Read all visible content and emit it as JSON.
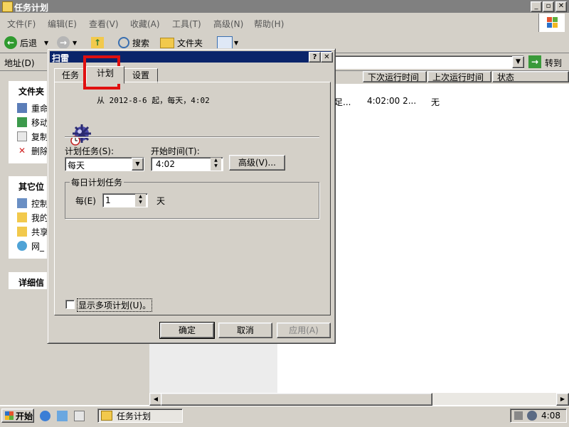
{
  "window": {
    "title": "任务计划"
  },
  "menu": [
    "文件(F)",
    "编辑(E)",
    "查看(V)",
    "收藏(A)",
    "工具(T)",
    "高级(N)",
    "帮助(H)"
  ],
  "toolbar": {
    "back": "后退",
    "search": "搜索",
    "folders": "文件夹"
  },
  "address": {
    "label": "地址(D)",
    "go": "转到"
  },
  "leftpane": {
    "file_tasks": {
      "title": "文件夹",
      "items": [
        "重命",
        "移动",
        "复制",
        "删除"
      ]
    },
    "other_places": {
      "title": "其它位",
      "items": [
        "控制",
        "我的",
        "共享",
        "网_"
      ]
    },
    "details": {
      "title": "详细信"
    }
  },
  "list": {
    "columns": [
      "下次运行时间",
      "上次运行时间",
      "状态"
    ],
    "row": {
      "c0": "足...",
      "c1": "4:02:00  2...",
      "c2": "无"
    }
  },
  "dialog": {
    "title": "扫雷",
    "tabs": [
      "任务",
      "计划",
      "设置"
    ],
    "summary": "从 2012-8-6 起，每天，4:02",
    "schedule_task_label": "计划任务(S):",
    "schedule_task_value": "每天",
    "start_time_label": "开始时间(T):",
    "start_time_value": "4:02",
    "advanced_button": "高级(V)...",
    "group_title": "每日计划任务",
    "every_label": "每(E)",
    "every_value": "1",
    "unit": "天",
    "multi_checkbox": "显示多项计划(U)。",
    "ok": "确定",
    "cancel": "取消",
    "apply": "应用(A)"
  },
  "taskbar": {
    "start": "开始",
    "task": "任务计划",
    "clock": "4:08"
  },
  "colors": {
    "title_inactive": "#808080",
    "title_active": "#0a246a",
    "highlight": "#e01010",
    "face": "#d4d0c8"
  }
}
